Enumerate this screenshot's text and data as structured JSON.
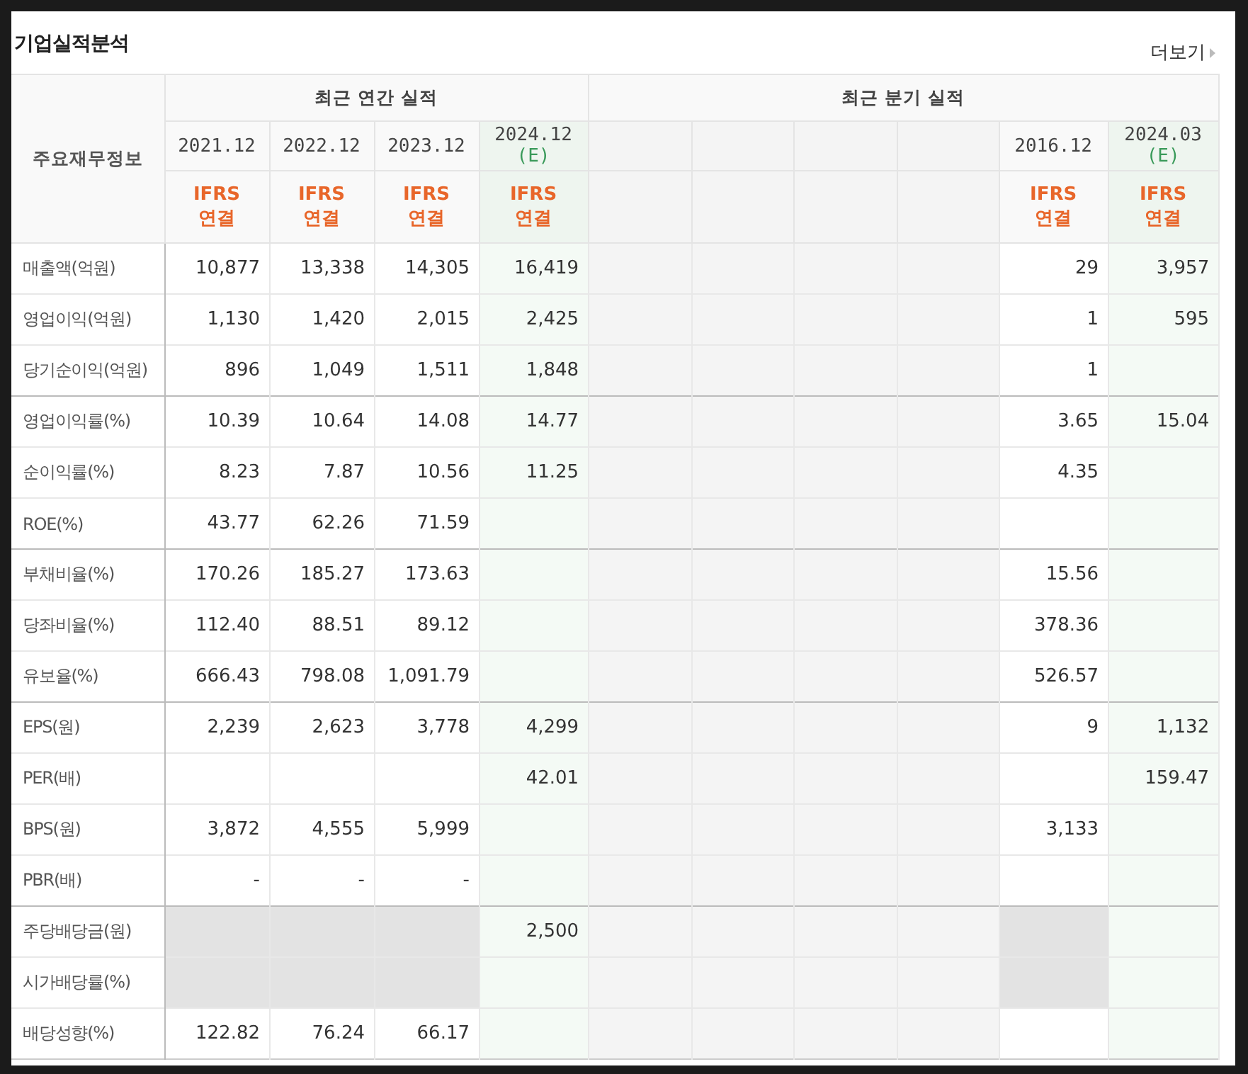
{
  "title": "기업실적분석",
  "more_link": "더보기",
  "table": {
    "corner": "주요재무정보",
    "groups": [
      {
        "label": "최근 연간 실적",
        "columns": [
          {
            "kind": "actual",
            "period": "2021.12",
            "basis": "IFRS 연결"
          },
          {
            "kind": "actual",
            "period": "2022.12",
            "basis": "IFRS 연결"
          },
          {
            "kind": "actual",
            "period": "2023.12",
            "basis": "IFRS 연결"
          },
          {
            "kind": "estimate",
            "period": "2024.12",
            "mark": "(E)",
            "basis": "IFRS 연결"
          }
        ]
      },
      {
        "label": "최근 분기 실적",
        "columns": [
          {
            "kind": "blank"
          },
          {
            "kind": "blank"
          },
          {
            "kind": "blank"
          },
          {
            "kind": "blank"
          },
          {
            "kind": "actual",
            "period": "2016.12",
            "basis": "IFRS 연결"
          },
          {
            "kind": "estimate",
            "period": "2024.03",
            "mark": "(E)",
            "basis": "IFRS 연결"
          }
        ]
      }
    ],
    "rows": [
      {
        "label": "매출액(억원)",
        "divider": true,
        "shaded": false,
        "cells": [
          {
            "value": "10,877"
          },
          {
            "value": "13,338"
          },
          {
            "value": "14,305"
          },
          {
            "value": "16,419"
          },
          {},
          {},
          {},
          {},
          {
            "value": "29"
          },
          {
            "value": "3,957"
          }
        ]
      },
      {
        "label": "영업이익(억원)",
        "divider": false,
        "shaded": false,
        "cells": [
          {
            "value": "1,130"
          },
          {
            "value": "1,420"
          },
          {
            "value": "2,015"
          },
          {
            "value": "2,425"
          },
          {},
          {},
          {},
          {},
          {
            "value": "1"
          },
          {
            "value": "595"
          }
        ]
      },
      {
        "label": "당기순이익(억원)",
        "divider": false,
        "shaded": false,
        "cells": [
          {
            "value": "896"
          },
          {
            "value": "1,049"
          },
          {
            "value": "1,511"
          },
          {
            "value": "1,848"
          },
          {},
          {},
          {},
          {},
          {
            "value": "1"
          },
          {}
        ]
      },
      {
        "label": "영업이익률(%)",
        "divider": true,
        "shaded": false,
        "cells": [
          {
            "value": "10.39"
          },
          {
            "value": "10.64"
          },
          {
            "value": "14.08"
          },
          {
            "value": "14.77"
          },
          {},
          {},
          {},
          {},
          {
            "value": "3.65"
          },
          {
            "value": "15.04"
          }
        ]
      },
      {
        "label": "순이익률(%)",
        "divider": false,
        "shaded": false,
        "cells": [
          {
            "value": "8.23"
          },
          {
            "value": "7.87"
          },
          {
            "value": "10.56"
          },
          {
            "value": "11.25"
          },
          {},
          {},
          {},
          {},
          {
            "value": "4.35"
          },
          {}
        ]
      },
      {
        "label": "ROE(%)",
        "divider": false,
        "shaded": false,
        "cells": [
          {
            "value": "43.77"
          },
          {
            "value": "62.26"
          },
          {
            "value": "71.59"
          },
          {},
          {},
          {},
          {},
          {},
          {},
          {}
        ]
      },
      {
        "label": "부채비율(%)",
        "divider": true,
        "shaded": false,
        "cells": [
          {
            "value": "170.26"
          },
          {
            "value": "185.27"
          },
          {
            "value": "173.63"
          },
          {},
          {},
          {},
          {},
          {},
          {
            "value": "15.56"
          },
          {}
        ]
      },
      {
        "label": "당좌비율(%)",
        "divider": false,
        "shaded": false,
        "cells": [
          {
            "value": "112.40"
          },
          {
            "value": "88.51"
          },
          {
            "value": "89.12"
          },
          {},
          {},
          {},
          {},
          {},
          {
            "value": "378.36"
          },
          {}
        ]
      },
      {
        "label": "유보율(%)",
        "divider": false,
        "shaded": false,
        "cells": [
          {
            "value": "666.43"
          },
          {
            "value": "798.08"
          },
          {
            "value": "1,091.79"
          },
          {},
          {},
          {},
          {},
          {},
          {
            "value": "526.57"
          },
          {}
        ]
      },
      {
        "label": "EPS(원)",
        "divider": true,
        "shaded": false,
        "cells": [
          {
            "value": "2,239"
          },
          {
            "value": "2,623"
          },
          {
            "value": "3,778"
          },
          {
            "value": "4,299"
          },
          {},
          {},
          {},
          {},
          {
            "value": "9"
          },
          {
            "value": "1,132"
          }
        ]
      },
      {
        "label": "PER(배)",
        "divider": false,
        "shaded": false,
        "cells": [
          {},
          {},
          {},
          {
            "value": "42.01"
          },
          {},
          {},
          {},
          {},
          {},
          {
            "value": "159.47"
          }
        ]
      },
      {
        "label": "BPS(원)",
        "divider": false,
        "shaded": false,
        "cells": [
          {
            "value": "3,872"
          },
          {
            "value": "4,555"
          },
          {
            "value": "5,999"
          },
          {},
          {},
          {},
          {},
          {},
          {
            "value": "3,133"
          },
          {}
        ]
      },
      {
        "label": "PBR(배)",
        "divider": false,
        "shaded": false,
        "cells": [
          {
            "value": "-"
          },
          {
            "value": "-"
          },
          {
            "value": "-"
          },
          {},
          {},
          {},
          {},
          {},
          {},
          {}
        ]
      },
      {
        "label": "주당배당금(원)",
        "divider": true,
        "shaded": true,
        "cells": [
          {},
          {},
          {},
          {
            "value": "2,500"
          },
          {},
          {},
          {},
          {},
          {},
          {}
        ]
      },
      {
        "label": "시가배당률(%)",
        "divider": false,
        "shaded": true,
        "cells": [
          {},
          {},
          {},
          {},
          {},
          {},
          {},
          {},
          {},
          {}
        ]
      },
      {
        "label": "배당성향(%)",
        "divider": false,
        "shaded": false,
        "cells": [
          {
            "value": "122.82"
          },
          {
            "value": "76.24"
          },
          {
            "value": "66.17"
          },
          {},
          {},
          {},
          {},
          {},
          {},
          {}
        ]
      }
    ]
  }
}
